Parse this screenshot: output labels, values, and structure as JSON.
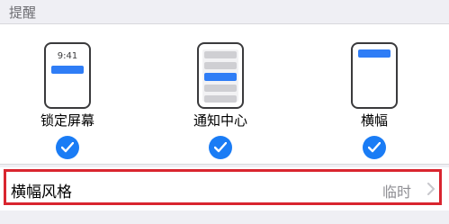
{
  "section": {
    "title": "提醒"
  },
  "options": [
    {
      "label": "锁定屏幕",
      "time": "9:41",
      "selected": true
    },
    {
      "label": "通知中心",
      "selected": true
    },
    {
      "label": "横幅",
      "selected": true
    }
  ],
  "banner_style": {
    "label": "横幅风格",
    "value": "临时"
  },
  "colors": {
    "accent": "#1a7cf5",
    "highlight_border": "#d9252f",
    "background": "#efeff4"
  }
}
